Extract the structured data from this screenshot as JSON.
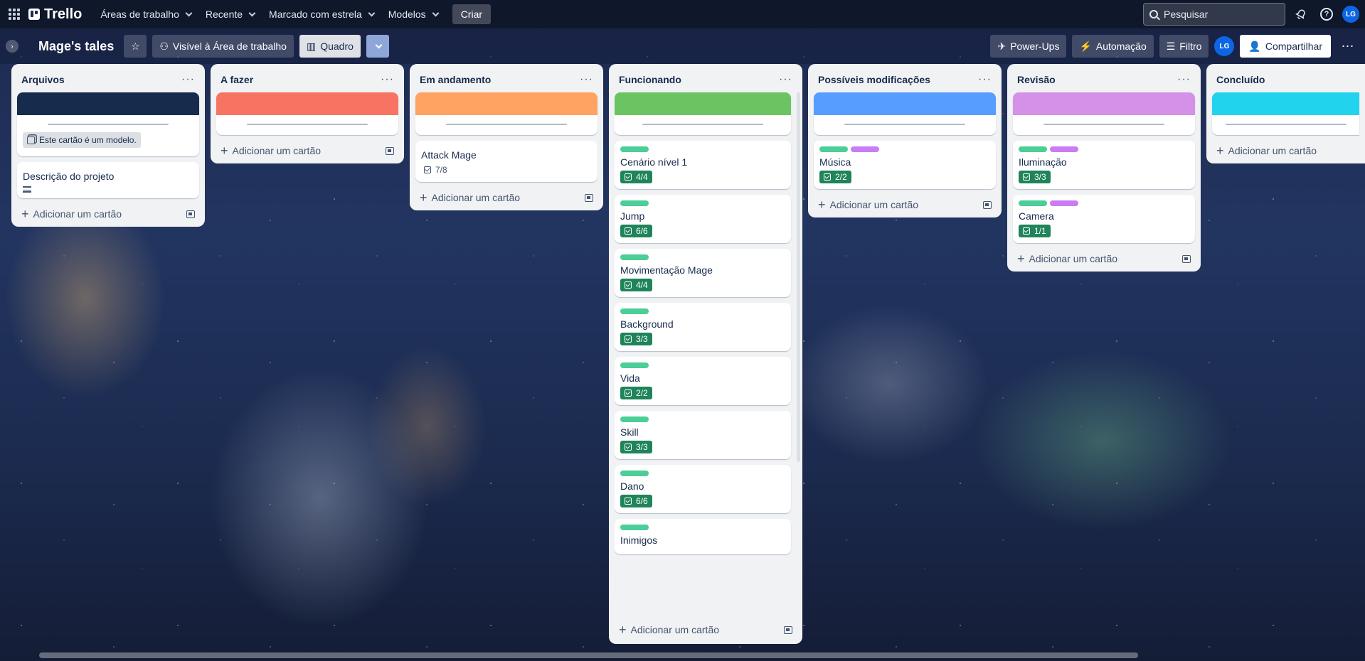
{
  "topbar": {
    "logo": "Trello",
    "nav": [
      {
        "label": "Áreas de trabalho"
      },
      {
        "label": "Recente"
      },
      {
        "label": "Marcado com estrela"
      },
      {
        "label": "Modelos"
      }
    ],
    "create_label": "Criar",
    "search_placeholder": "Pesquisar",
    "avatar": "LG"
  },
  "board": {
    "title": "Mage's tales",
    "visibility_label": "Visível à Área de trabalho",
    "view_label": "Quadro",
    "powerups_label": "Power-Ups",
    "automation_label": "Automação",
    "filter_label": "Filtro",
    "share_label": "Compartilhar",
    "avatar": "LG"
  },
  "lists": [
    {
      "title": "Arquivos",
      "cover_color": "#172b4d",
      "template_badge": "Este cartão é um modelo.",
      "cards": [
        {
          "title": "Descrição do projeto"
        }
      ],
      "add_label": "Adicionar um cartão"
    },
    {
      "title": "A fazer",
      "cover_color": "#f87462",
      "add_label": "Adicionar um cartão"
    },
    {
      "title": "Em andamento",
      "cover_color": "#fea362",
      "cards": [
        {
          "title": "Attack Mage",
          "checklist": "7/8"
        }
      ],
      "add_label": "Adicionar um cartão"
    },
    {
      "title": "Funcionando",
      "cover_color": "#6cc361",
      "cards": [
        {
          "title": "Cenário nível 1",
          "checklist": "4/4"
        },
        {
          "title": "Jump",
          "checklist": "6/6"
        },
        {
          "title": "Movimentação Mage",
          "checklist": "4/4"
        },
        {
          "title": "Background",
          "checklist": "3/3"
        },
        {
          "title": "Vida",
          "checklist": "2/2"
        },
        {
          "title": "Skill",
          "checklist": "3/3"
        },
        {
          "title": "Dano",
          "checklist": "6/6"
        },
        {
          "title": "Inimigos"
        }
      ],
      "add_label": "Adicionar um cartão"
    },
    {
      "title": "Possíveis modificações",
      "cover_color": "#579dff",
      "cards": [
        {
          "title": "Música",
          "checklist": "2/2"
        }
      ],
      "add_label": "Adicionar um cartão"
    },
    {
      "title": "Revisão",
      "cover_color": "#d591e8",
      "cards": [
        {
          "title": "Iluminação",
          "checklist": "3/3"
        },
        {
          "title": "Camera",
          "checklist": "1/1"
        }
      ],
      "add_label": "Adicionar um cartão"
    },
    {
      "title": "Concluído",
      "cover_color": "#22d3ee",
      "add_label": "Adicionar um cartão"
    }
  ],
  "colors": {
    "label_green": "#4bce97",
    "label_purple": "#c97cf4",
    "checklist_badge": "#1f845a"
  }
}
